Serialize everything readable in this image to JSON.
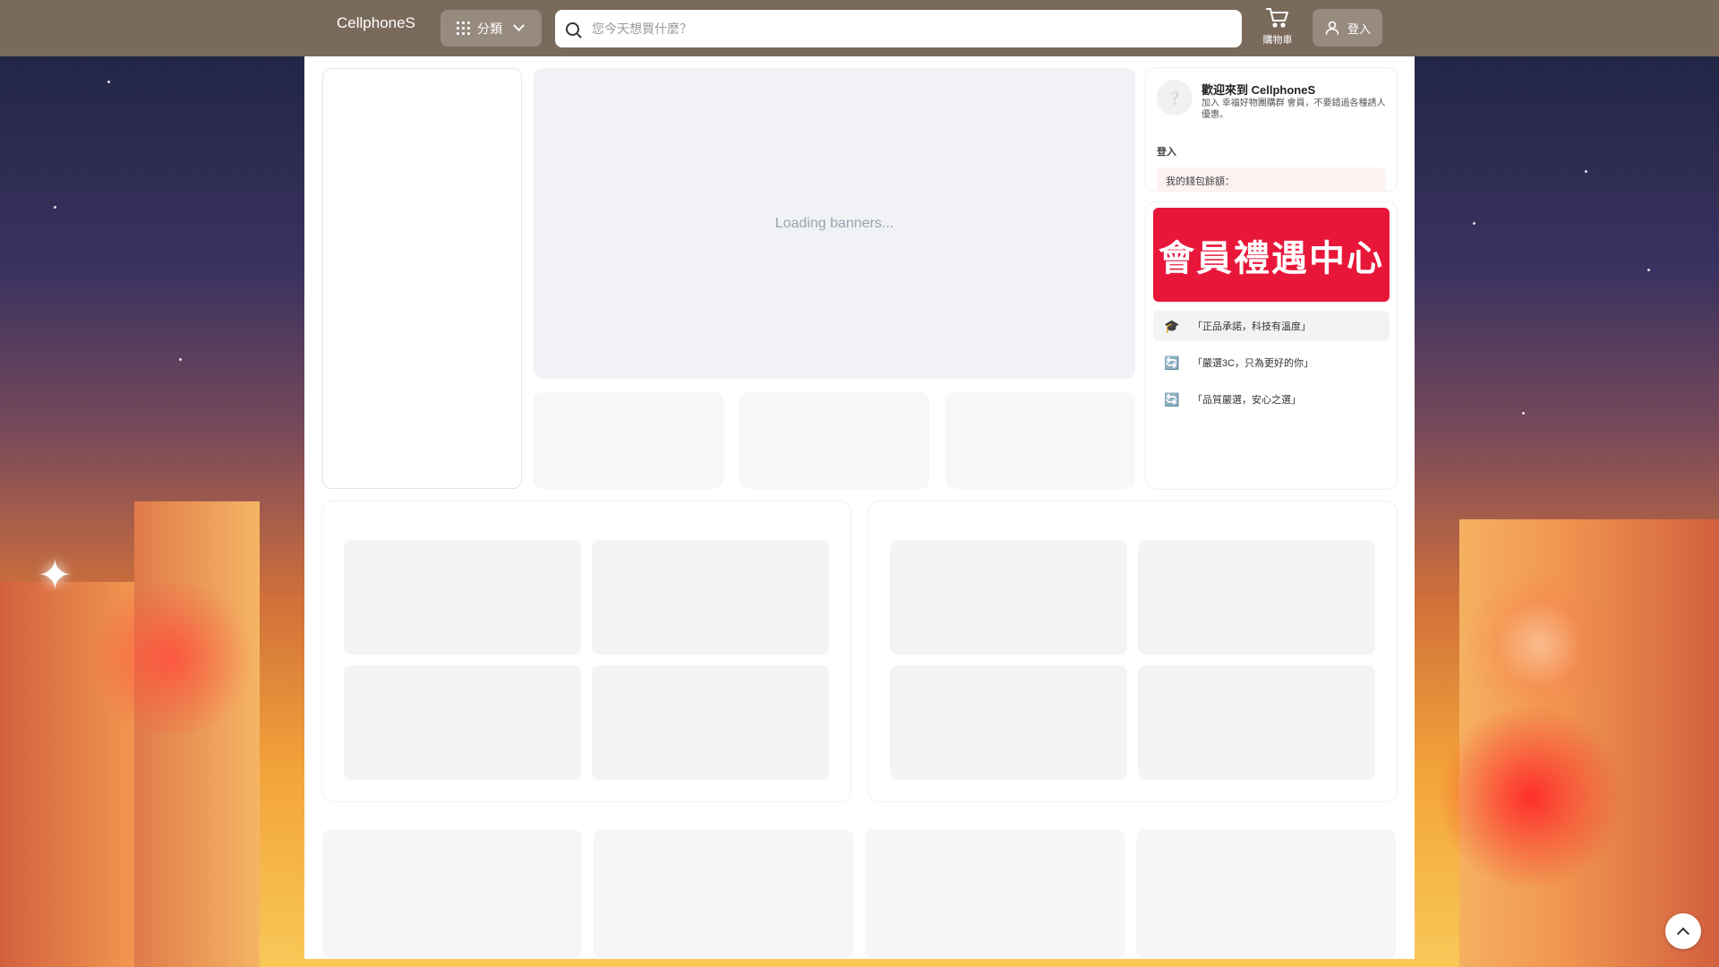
{
  "header": {
    "logo_text": "CellphoneS",
    "category_label": "分類",
    "search_placeholder": "您今天想買什麼？",
    "cart_label": "購物車",
    "login_label": "登入"
  },
  "banner": {
    "loading_text": "Loading banners..."
  },
  "profile": {
    "avatar_glyph": "❔",
    "welcome_title": "歡迎來到 CellphoneS",
    "welcome_sub": "加入 幸福好物團購群 會員，不要錯過各種誘人優惠。",
    "login_link": "登入",
    "wallet_label": "我的錢包餘額："
  },
  "promo": {
    "banner_text": "會員禮遇中心",
    "items": [
      {
        "icon": "graduation-cap-icon",
        "glyph": "🎓",
        "label": "「正品承諾，科技有溫度」"
      },
      {
        "icon": "refresh-icon",
        "glyph": "🔄",
        "label": "「嚴選3C，只為更好的你」"
      },
      {
        "icon": "refresh-icon",
        "glyph": "🔄",
        "label": "「品質嚴選，安心之選」"
      }
    ]
  },
  "colors": {
    "header_bg": "#7a6a5c",
    "promo_red": "#e8173a",
    "banner_placeholder": "#f0f2f6"
  }
}
